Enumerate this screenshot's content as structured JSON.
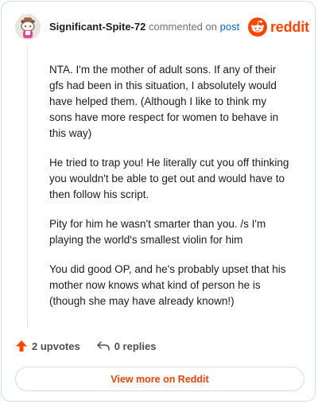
{
  "comment": {
    "username": "Significant-Spite-72",
    "commented_on": "commented on",
    "post_link": "post",
    "paragraphs": [
      "NTA. I'm the mother of adult sons. If any of their gfs had been in this situation, I absolutely would have helped them. (Although I like to think my sons have more respect for women to behave in this way)",
      "He tried to trap you! He literally cut you off thinking you wouldn't be able to get out and would have to then follow his script.",
      "Pity for him he wasn't smarter than you. /s I'm playing the world's smallest violin for him",
      "You did good OP, and he's probably upset that his mother now knows what kind of person he is (though she may have already known!)"
    ]
  },
  "brand": {
    "wordmark": "reddit",
    "color": "#ff4500"
  },
  "actions": {
    "upvotes_label": "2 upvotes",
    "replies_label": "0 replies"
  },
  "footer": {
    "view_more_label": "View more on Reddit"
  },
  "icons": {
    "avatar": "snoo-avatar",
    "upvote": "upvote-arrow-icon",
    "reply": "reply-arrow-icon",
    "logo": "reddit-logo-icon"
  },
  "colors": {
    "accent": "#ff4500",
    "link": "#0a66c2",
    "muted": "#6a7177",
    "border": "#d8dde0"
  }
}
